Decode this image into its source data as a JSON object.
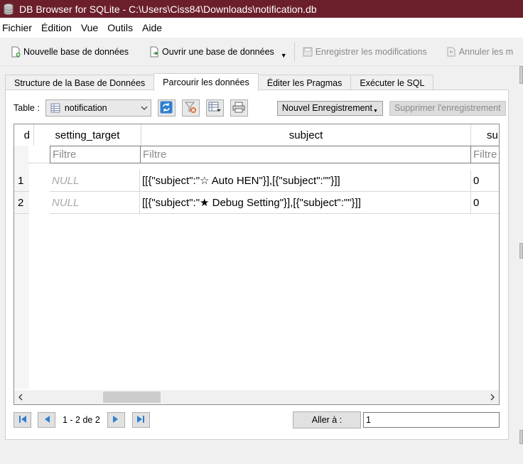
{
  "window": {
    "title": "DB Browser for SQLite - C:\\Users\\Ciss84\\Downloads\\notification.db",
    "titlebar_color": "#6b1f2a"
  },
  "menu": [
    "Fichier",
    "Édition",
    "Vue",
    "Outils",
    "Aide"
  ],
  "toolbar": {
    "new_db": "Nouvelle base de données",
    "open_db": "Ouvrir une base de données",
    "write_changes": "Enregistrer les modifications",
    "revert_changes": "Annuler les m"
  },
  "tabs": [
    "Structure de la Base de Données",
    "Parcourir les données",
    "Éditer les Pragmas",
    "Exécuter le SQL"
  ],
  "active_tab": 1,
  "browse": {
    "table_label": "Table :",
    "table_name": "notification",
    "new_record": "Nouvel Enregistrement",
    "delete_record": "Supprimer l'enregistrement"
  },
  "grid": {
    "columns": [
      "d",
      "setting_target",
      "subject",
      "su"
    ],
    "filter_placeholder": "Filtre",
    "rows": [
      {
        "num": "1",
        "setting_target": "NULL",
        "subject": "[[{\"subject\":\"☆ Auto HEN\"}],[{\"subject\":\"\"}]]",
        "su": "0"
      },
      {
        "num": "2",
        "setting_target": "NULL",
        "subject": "[[{\"subject\":\"★ Debug Setting\"}],[{\"subject\":\"\"}]]",
        "su": "0"
      }
    ]
  },
  "nav": {
    "position": "1 - 2 de 2",
    "goto_label": "Aller à :",
    "goto_value": "1"
  }
}
